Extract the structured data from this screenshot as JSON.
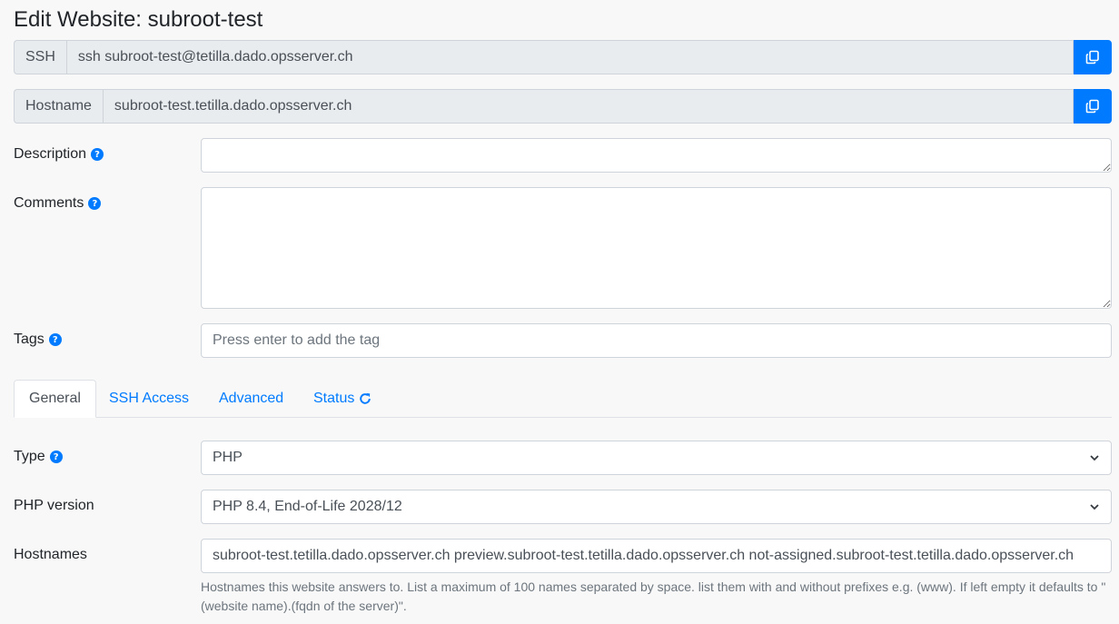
{
  "title": "Edit Website: subroot-test",
  "ssh": {
    "label": "SSH",
    "value": "ssh subroot-test@tetilla.dado.opsserver.ch"
  },
  "hostname": {
    "label": "Hostname",
    "value": "subroot-test.tetilla.dado.opsserver.ch"
  },
  "description": {
    "label": "Description",
    "value": ""
  },
  "comments": {
    "label": "Comments",
    "value": ""
  },
  "tags": {
    "label": "Tags",
    "placeholder": "Press enter to add the tag"
  },
  "tabs": [
    {
      "label": "General"
    },
    {
      "label": "SSH Access"
    },
    {
      "label": "Advanced"
    },
    {
      "label": "Status"
    }
  ],
  "type": {
    "label": "Type",
    "value": "PHP"
  },
  "php_version": {
    "label": "PHP version",
    "value": "PHP 8.4, End-of-Life 2028/12"
  },
  "hostnames": {
    "label": "Hostnames",
    "value": "subroot-test.tetilla.dado.opsserver.ch preview.subroot-test.tetilla.dado.opsserver.ch not-assigned.subroot-test.tetilla.dado.opsserver.ch",
    "help": "Hostnames this website answers to. List a maximum of 100 names separated by space. list them with and without prefixes e.g. (www). If left empty it defaults to \"(website name).(fqdn of the server)\"."
  },
  "colors": {
    "accent": "#007bff",
    "readonly_bg": "#e9ecef"
  }
}
